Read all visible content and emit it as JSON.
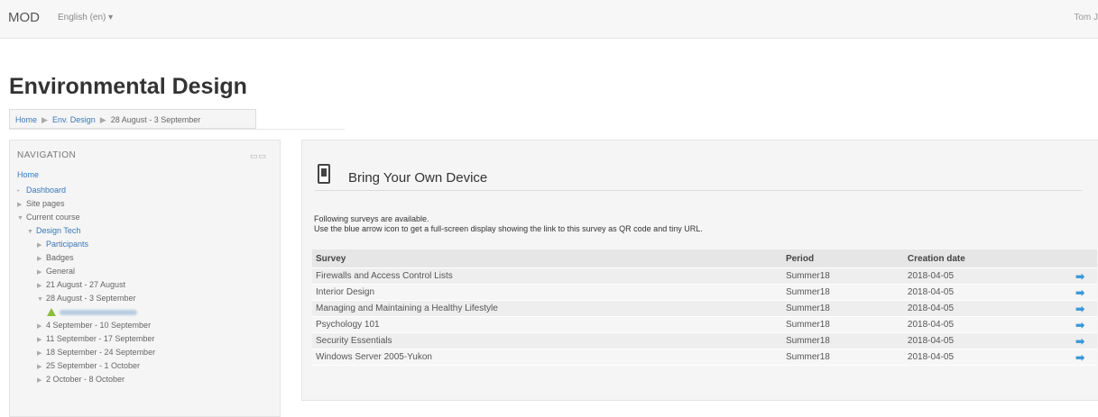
{
  "topbar": {
    "brand": "MOD",
    "language": "English (en) ▾",
    "user": "Tom J"
  },
  "page_title": "Environmental Design",
  "breadcrumb": [
    "Home",
    "Env. Design",
    "28 August - 3 September"
  ],
  "navigation": {
    "title": "NAVIGATION",
    "home": "Home",
    "items": [
      {
        "label": "Dashboard",
        "marker": "•",
        "indent": 1,
        "link": true
      },
      {
        "label": "Site pages",
        "marker": "▶",
        "indent": 1,
        "link": false
      },
      {
        "label": "Current course",
        "marker": "▼",
        "indent": 1,
        "link": false
      },
      {
        "label": "Design Tech",
        "marker": "▼",
        "indent": 2,
        "link": true
      },
      {
        "label": "Participants",
        "marker": "▶",
        "indent": 3,
        "link": true
      },
      {
        "label": "Badges",
        "marker": "▶",
        "indent": 3,
        "link": false
      },
      {
        "label": "General",
        "marker": "▶",
        "indent": 3,
        "link": false
      },
      {
        "label": "21 August - 27 August",
        "marker": "▶",
        "indent": 3,
        "link": false
      },
      {
        "label": "28 August - 3 September",
        "marker": "▼",
        "indent": 3,
        "link": false
      },
      {
        "label": "",
        "marker": "",
        "indent": 4,
        "link": true,
        "blurred": true
      },
      {
        "label": "4 September - 10 September",
        "marker": "▶",
        "indent": 3,
        "link": false
      },
      {
        "label": "11 September - 17 September",
        "marker": "▶",
        "indent": 3,
        "link": false
      },
      {
        "label": "18 September - 24 September",
        "marker": "▶",
        "indent": 3,
        "link": false
      },
      {
        "label": "25 September - 1 October",
        "marker": "▶",
        "indent": 3,
        "link": false
      },
      {
        "label": "2 October - 8 October",
        "marker": "▶",
        "indent": 3,
        "link": false
      }
    ]
  },
  "byod": {
    "title": "Bring Your Own Device",
    "intro_line1": "Following surveys are available.",
    "intro_line2": "Use the blue arrow icon to get a full-screen display showing the link to this survey as QR code and tiny URL.",
    "columns": [
      "Survey",
      "Period",
      "Creation date"
    ],
    "rows": [
      {
        "survey": "Firewalls and Access Control Lists",
        "period": "Summer18",
        "date": "2018-04-05"
      },
      {
        "survey": "Interior Design",
        "period": "Summer18",
        "date": "2018-04-05"
      },
      {
        "survey": "Managing and Maintaining a Healthy Lifestyle",
        "period": "Summer18",
        "date": "2018-04-05"
      },
      {
        "survey": "Psychology 101",
        "period": "Summer18",
        "date": "2018-04-05"
      },
      {
        "survey": "Security Essentials",
        "period": "Summer18",
        "date": "2018-04-05"
      },
      {
        "survey": "Windows Server 2005-Yukon",
        "period": "Summer18",
        "date": "2018-04-05"
      }
    ],
    "action_glyph": "➡"
  }
}
